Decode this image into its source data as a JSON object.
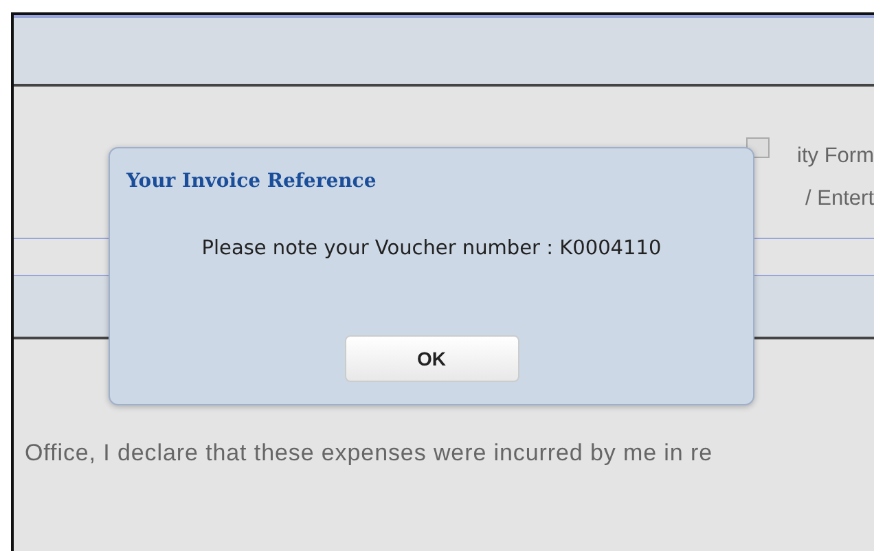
{
  "form": {
    "checkbox": {
      "checked": false
    },
    "field_labels": [
      "ity Form",
      "/ Entert"
    ],
    "declaration": "Office, I declare that these expenses were incurred by me in re"
  },
  "dialog": {
    "title": "Your Invoice Reference",
    "message": "Please note your Voucher number : K0004110",
    "buttons": [
      "OK"
    ]
  }
}
